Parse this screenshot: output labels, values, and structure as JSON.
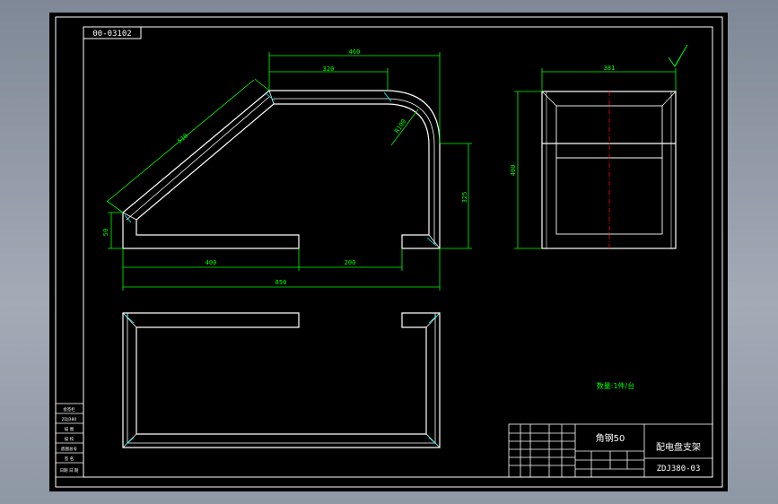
{
  "drawing": {
    "code_box": "00-03102",
    "dims": {
      "top_total": "460",
      "top_straight": "320",
      "radius": "R100",
      "slope": "510",
      "left_small": "50",
      "right_vertical": "325",
      "bottom_left": "400",
      "bottom_right": "200",
      "overall": "850",
      "side_width": "381",
      "side_height": "400"
    },
    "note": "数量:1件/台",
    "title_block": {
      "material": "角钢50",
      "part_name": "配电盘支架",
      "drawing_no": "ZDJ380-03"
    },
    "left_strip": [
      "会签栏",
      "ZDJ380",
      "描 图",
      "描 校",
      "底图总号",
      "签 名",
      "日期 日 期"
    ],
    "colors": {
      "background": "#000000",
      "line": "#ffffff",
      "dimension": "#00ff00",
      "center": "#ff0000",
      "frame": "#ffffff",
      "viewport": "#8d96a3"
    }
  }
}
